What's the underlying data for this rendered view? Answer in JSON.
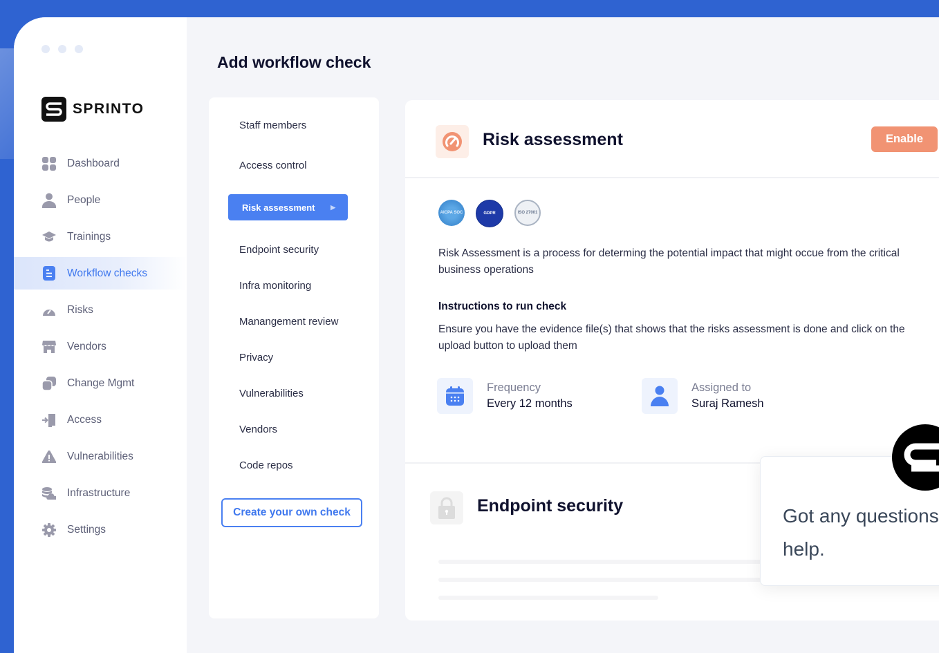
{
  "colors": {
    "brand_blue": "#2f63d1",
    "accent": "#4a80f1",
    "enable_orange": "#f19373",
    "text_dark": "#10122e"
  },
  "app": {
    "logo_text": "SPRINTO",
    "logo_icon": "sprinto-s-icon"
  },
  "sidebar": {
    "items": [
      {
        "label": "Dashboard",
        "icon": "dashboard-icon",
        "active": false
      },
      {
        "label": "People",
        "icon": "person-icon",
        "active": false
      },
      {
        "label": "Trainings",
        "icon": "graduation-cap-icon",
        "active": false
      },
      {
        "label": "Workflow checks",
        "icon": "document-list-icon",
        "active": true
      },
      {
        "label": "Risks",
        "icon": "gauge-icon",
        "active": false
      },
      {
        "label": "Vendors",
        "icon": "store-icon",
        "active": false
      },
      {
        "label": "Change Mgmt",
        "icon": "copy-icon",
        "active": false
      },
      {
        "label": "Access",
        "icon": "sign-in-icon",
        "active": false
      },
      {
        "label": "Vulnerabilities",
        "icon": "warning-icon",
        "active": false
      },
      {
        "label": "Infrastructure",
        "icon": "database-cloud-icon",
        "active": false
      },
      {
        "label": "Settings",
        "icon": "gear-icon",
        "active": false
      }
    ]
  },
  "main": {
    "page_title": "Add workflow check",
    "checks": [
      {
        "label": "Staff members"
      },
      {
        "label": "Access control"
      },
      {
        "label": "Risk assessment",
        "active": true
      },
      {
        "label": "Endpoint security"
      },
      {
        "label": "Infra monitoring"
      },
      {
        "label": "Manangement review"
      },
      {
        "label": "Privacy"
      },
      {
        "label": "Vulnerabilities"
      },
      {
        "label": "Vendors"
      },
      {
        "label": "Code repos"
      }
    ],
    "create_button": "Create your own check"
  },
  "detail": {
    "title": "Risk assessment",
    "enable_button": "Enable",
    "badges": [
      {
        "name": "aicpa-soc-badge",
        "text": "AICPA SOC"
      },
      {
        "name": "gdpr-badge",
        "text": "GDPR"
      },
      {
        "name": "iso-27001-badge",
        "text": "ISO 27001"
      }
    ],
    "description": "Risk Assessment is a process for determing the potential impact that might occue from the critical business operations",
    "instructions_title": "Instructions to run check",
    "instructions": "Ensure you have the evidence file(s) that shows that the risks assessment is done and click on the upload button to upload them",
    "frequency_label": "Frequency",
    "frequency_value": "Every 12 months",
    "assigned_label": "Assigned to",
    "assigned_value": "Suraj Ramesh",
    "next_title": "Endpoint security"
  },
  "chat": {
    "line1": "Got any questions",
    "line2": "help."
  }
}
